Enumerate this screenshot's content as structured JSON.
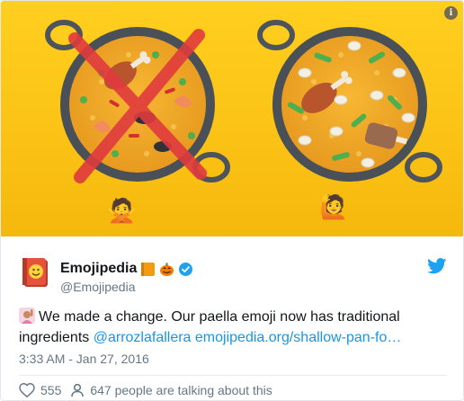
{
  "media": {
    "info_icon": "i",
    "left_pan": {
      "description_icon": "paella-pan-old-icon",
      "crossed_out": true
    },
    "right_pan": {
      "description_icon": "paella-pan-new-icon"
    },
    "left_gesture": "🙅",
    "right_gesture": "🙋"
  },
  "tweet": {
    "display_name": "Emojipedia",
    "badge_emoji_1": "book-icon",
    "badge_emoji_2": "jack-o-lantern-icon",
    "verified_icon": "verified-badge-icon",
    "handle": "@Emojipedia",
    "text_plain": "We made a change. Our paella emoji now has traditional",
    "text_line2_plain": "ingredients ",
    "mention": "@arrozlafallera",
    "url": "emojipedia.org/shallow-pan-fo…",
    "timestamp": "3:33 AM - Jan 27, 2016",
    "likes": "555",
    "talking": "647 people are talking about this"
  },
  "colors": {
    "background_yellow": "#fbc315",
    "link_blue": "#1b95e0",
    "twitter_blue": "#1da1f2",
    "cross_red": "#e03a3e"
  }
}
